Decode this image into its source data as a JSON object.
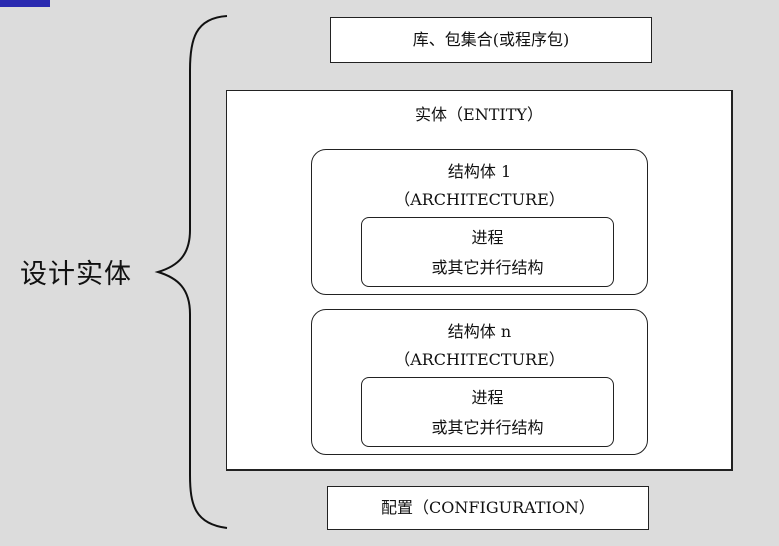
{
  "title": "设计实体",
  "library_box": "库、包集合(或程序包)",
  "entity": {
    "label": "实体（ENTITY）",
    "architectures": [
      {
        "name": "结构体 1",
        "keyword": "（ARCHITECTURE）",
        "process_line1": "进程",
        "process_line2": "或其它并行结构"
      },
      {
        "name": "结构体 n",
        "keyword": "（ARCHITECTURE）",
        "process_line1": "进程",
        "process_line2": "或其它并行结构"
      }
    ]
  },
  "configuration_box": "配置（CONFIGURATION）",
  "colors": {
    "background": "#dcdcdc",
    "box_fill": "#ffffff",
    "border": "#222222",
    "corner_mark": "#2a2ab0"
  }
}
